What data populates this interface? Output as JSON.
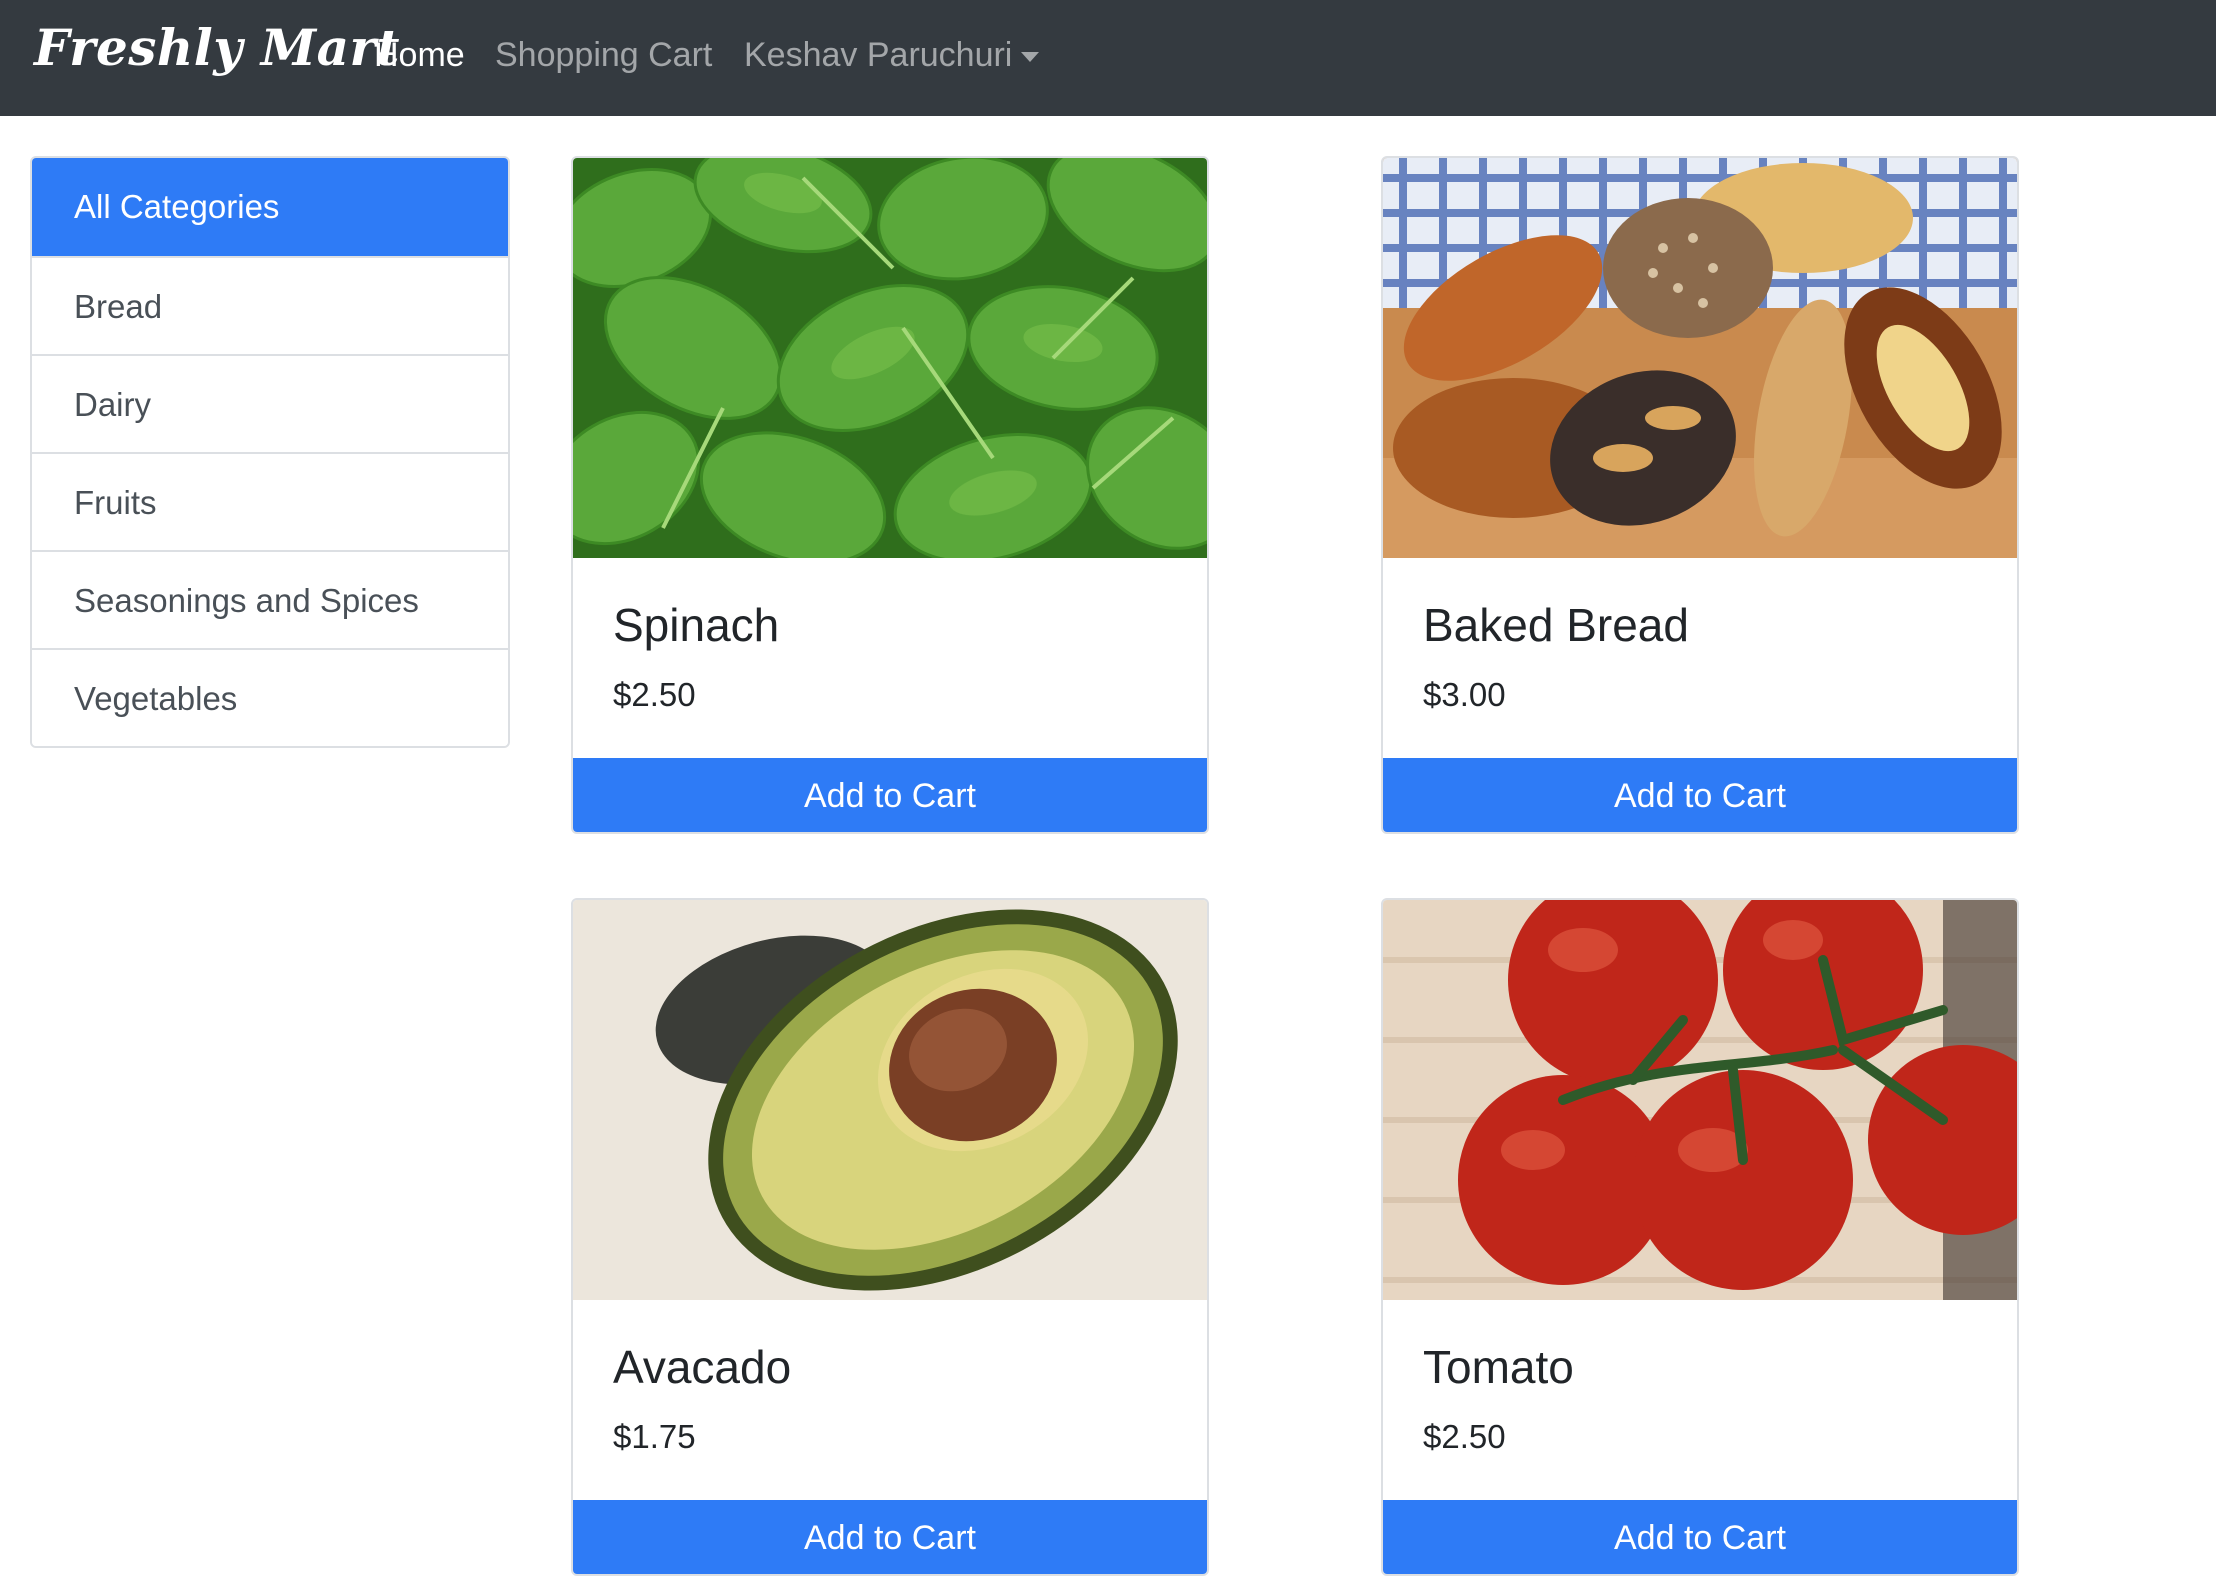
{
  "navbar": {
    "brand": "Freshly Mart",
    "links": {
      "home": "Home",
      "cart": "Shopping Cart",
      "user": "Keshav Paruchuri"
    }
  },
  "sidebar": {
    "items": [
      {
        "label": "All Categories",
        "active": true
      },
      {
        "label": "Bread"
      },
      {
        "label": "Dairy"
      },
      {
        "label": "Fruits"
      },
      {
        "label": "Seasonings and Spices"
      },
      {
        "label": "Vegetables"
      }
    ]
  },
  "products": [
    {
      "name": "Spinach",
      "price": "$2.50",
      "button": "Add to Cart",
      "image": "spinach"
    },
    {
      "name": "Baked Bread",
      "price": "$3.00",
      "button": "Add to Cart",
      "image": "bread"
    },
    {
      "name": "Avacado",
      "price": "$1.75",
      "button": "Add to Cart",
      "image": "avocado"
    },
    {
      "name": "Tomato",
      "price": "$2.50",
      "button": "Add to Cart",
      "image": "tomato"
    }
  ],
  "colors": {
    "navbar": "#343a40",
    "primary": "#2e7bf6"
  }
}
